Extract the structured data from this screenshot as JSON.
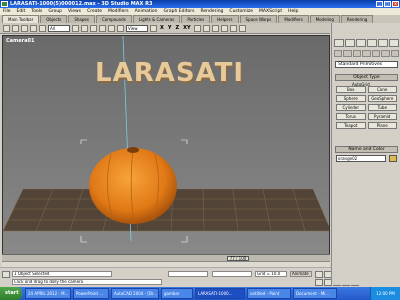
{
  "window": {
    "title": "LARASATI-1000(5)000012.max - 3D Studio MAX R3"
  },
  "menu": [
    "File",
    "Edit",
    "Tools",
    "Group",
    "Views",
    "Create",
    "Modifiers",
    "Animation",
    "Graph Editors",
    "Rendering",
    "Customize",
    "MAXScript",
    "Help"
  ],
  "tabs": [
    "Main Toolbar",
    "Objects",
    "Shapes",
    "Compounds",
    "Lights & Cameras",
    "Particles",
    "Helpers",
    "Space Warps",
    "Modifiers",
    "Modeling",
    "Rendering"
  ],
  "toolbar": {
    "selection_filter": "All",
    "coord_system": "View",
    "axis_x": "X",
    "axis_y": "Y",
    "axis_z": "Z",
    "axis_xy": "XY"
  },
  "viewport": {
    "label": "Camera01",
    "text_object": "LARASATI"
  },
  "timeline": {
    "frame_display": "77 / 100"
  },
  "status": {
    "selection_info": "1 Object Selected",
    "prompt": "Click and drag to dolly the camera",
    "coord_x": "",
    "coord_y": "",
    "grid_value": "Grid = 10.0",
    "animate_label": "Animate"
  },
  "command_panel": {
    "category": "Standard Primitives",
    "rollout_object_type": "Object Type",
    "autogrid_label": "AutoGrid",
    "buttons": [
      "Box",
      "Cone",
      "Sphere",
      "GeoSphere",
      "Cylinder",
      "Tube",
      "Torus",
      "Pyramid",
      "Teapot",
      "Plane"
    ],
    "rollout_name_color": "Name and Color",
    "object_name": "orange02",
    "object_color": "#e1b94c"
  },
  "taskbar": {
    "start_label": "start",
    "tasks": [
      "24 APRIL 2012 - M...",
      "PowerPoint ...",
      "AutoCAD 2004 - [Dr...",
      "gambar",
      "LARASATI-1000...",
      "untitled - Paint",
      "Document - Mi..."
    ],
    "clock": "12:00 PM"
  },
  "colors": {
    "titlebar": "#0a3fa6",
    "viewport_bg": "#737373",
    "text3d": "#e8c99a",
    "orange": "#e8861f",
    "taskbar": "#2458cc"
  }
}
